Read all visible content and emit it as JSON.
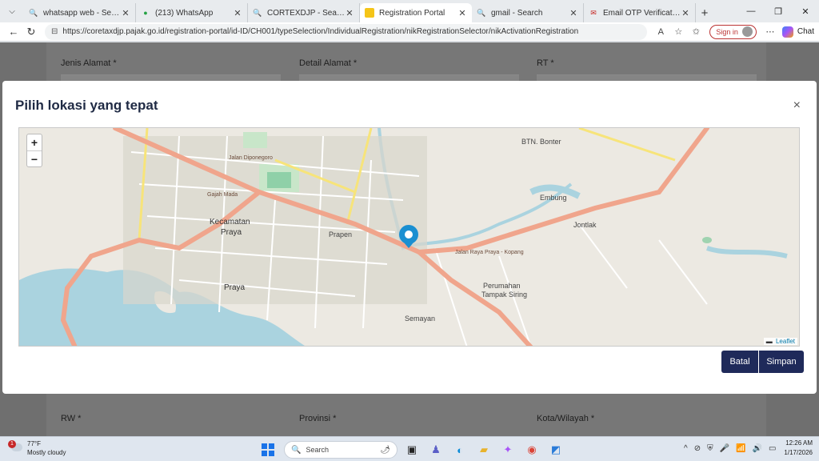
{
  "browser": {
    "tabs": [
      {
        "title": "whatsapp web - Search",
        "icon": "search-icon"
      },
      {
        "title": "(213) WhatsApp",
        "icon": "whatsapp-icon"
      },
      {
        "title": "CORTEXDJP - Search",
        "icon": "search-icon"
      },
      {
        "title": "Registration Portal",
        "icon": "portal-icon",
        "active": true
      },
      {
        "title": "gmail - Search",
        "icon": "search-icon"
      },
      {
        "title": "Email OTP Verification Code ·",
        "icon": "gmail-icon"
      }
    ],
    "url": "https://coretaxdjp.pajak.go.id/registration-portal/id-ID/CH001/typeSelection/IndividualRegistration/nikRegistrationSelector/nikActivationRegistration",
    "sign_in_label": "Sign in",
    "chat_label": "Chat"
  },
  "form": {
    "labels_top": [
      "Jenis Alamat *",
      "Detail Alamat *",
      "RT *"
    ],
    "labels_bottom": [
      "RW *",
      "Provinsi *",
      "Kota/Wilayah *"
    ]
  },
  "modal": {
    "title": "Pilih lokasi yang tepat",
    "close_symbol": "×",
    "zoom_in": "+",
    "zoom_out": "−",
    "attribution": "Leaflet",
    "batal_label": "Batal",
    "simpan_label": "Simpan",
    "map_labels": {
      "kecamatan": "Kecamatan",
      "praya1": "Praya",
      "praya2": "Praya",
      "semayan": "Semayan",
      "jontlak": "Jontlak",
      "embung": "Embung",
      "btn": "BTN. Bonter",
      "prapen": "Prapen",
      "perumahan": "Perumahan",
      "tampak_siring": "Tampak Siring",
      "road1": "Jalan Diponegoro",
      "road2": "Jalan Raya Praya - Kopang",
      "road3": "Gajah Mada"
    },
    "accent_color": "#1f2a5a",
    "marker_color": "#1a8fd1"
  },
  "taskbar": {
    "temperature": "77°F",
    "weather": "Mostly cloudy",
    "weather_badge": "1",
    "search_placeholder": "Search",
    "time": "12:26 AM",
    "date": "1/17/2026"
  }
}
